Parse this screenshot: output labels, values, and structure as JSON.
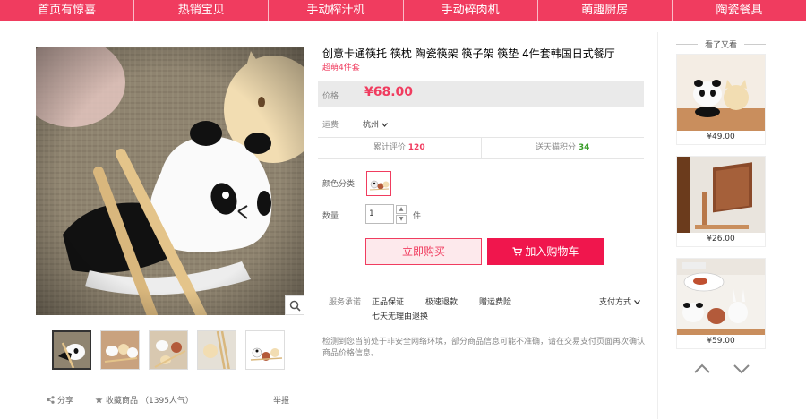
{
  "nav": [
    "首页有惊喜",
    "热销宝贝",
    "手动榨汁机",
    "手动碎肉机",
    "萌趣厨房",
    "陶瓷餐具"
  ],
  "product": {
    "title": "创意卡通筷托 筷枕 陶瓷筷架 筷子架 筷垫 4件套韩国日式餐厅",
    "subtitle": "超萌4件套",
    "price_label": "价格",
    "price": "¥68.00",
    "ship_label": "运费",
    "ship_city": "杭州",
    "reviews_label": "累计评价",
    "reviews_count": "120",
    "points_label": "送天猫积分",
    "points_count": "34",
    "color_label": "颜色分类",
    "qty_label": "数量",
    "qty_value": "1",
    "qty_unit": "件",
    "buy_now": "立即购买",
    "add_cart": "加入购物车",
    "promise_label": "服务承诺",
    "promises": [
      "正品保证",
      "极速退款",
      "赠运费险",
      "七天无理由退换"
    ],
    "pay_label": "支付方式",
    "notice": "检测到您当前处于非安全网络环境，部分商品信息可能不准确，请在交易支付页面再次确认商品价格信息。"
  },
  "share": {
    "share_label": "分享",
    "fav_label": "收藏商品",
    "fav_count": "（1395人气）",
    "report_label": "举报"
  },
  "sidebar": {
    "heading": "看了又看",
    "items": [
      {
        "price": "¥49.00"
      },
      {
        "price": "¥26.00"
      },
      {
        "price": "¥59.00"
      }
    ]
  },
  "colors": {
    "accent": "#f03c5f",
    "cart": "#f0164d",
    "green": "#3a9d2a"
  },
  "icons": [
    "zoom-icon",
    "share-icon",
    "star-icon",
    "cart-icon",
    "chevron-down-icon",
    "chevron-up-icon"
  ]
}
